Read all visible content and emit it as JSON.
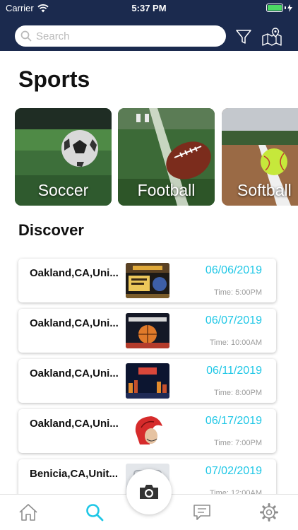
{
  "status_bar": {
    "carrier": "Carrier",
    "time": "5:37 PM",
    "battery_level": 1.0
  },
  "search": {
    "placeholder": "Search"
  },
  "header_icons": [
    "filter-icon",
    "map-icon"
  ],
  "page_title": "Sports",
  "sports": [
    {
      "label": "Soccer"
    },
    {
      "label": "Football"
    },
    {
      "label": "Softball"
    }
  ],
  "discover_title": "Discover",
  "events": [
    {
      "location": "Oakland,CA,Uni...",
      "date": "06/06/2019",
      "time": "Time: 5:00PM"
    },
    {
      "location": "Oakland,CA,Uni...",
      "date": "06/07/2019",
      "time": "Time: 10:00AM"
    },
    {
      "location": "Oakland,CA,Uni...",
      "date": "06/11/2019",
      "time": "Time: 8:00PM"
    },
    {
      "location": "Oakland,CA,Uni...",
      "date": "06/17/2019",
      "time": "Time: 7:00PM"
    },
    {
      "location": "Benicia,CA,Unit...",
      "date": "07/02/2019",
      "time": "Time: 12:00AM"
    }
  ],
  "tabs": [
    "home-icon",
    "search-icon",
    "camera-icon",
    "chat-icon",
    "settings-icon"
  ],
  "colors": {
    "header": "#1b2a4e",
    "accent": "#1fc7e6",
    "battery": "#4cd964"
  }
}
